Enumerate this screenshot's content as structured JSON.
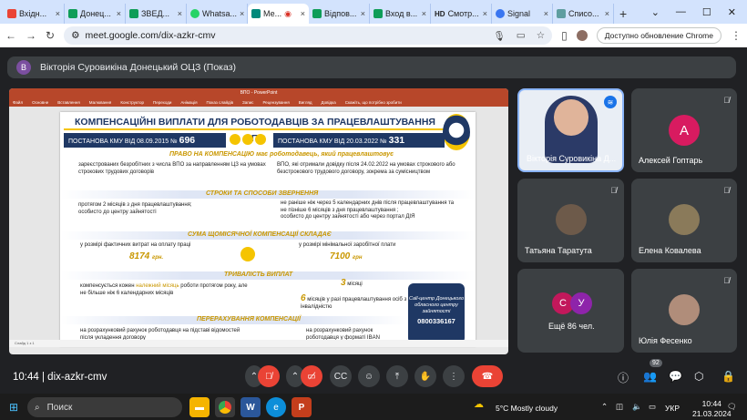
{
  "browser": {
    "tabs": [
      {
        "title": "Вхідн...",
        "color": "#ea4335"
      },
      {
        "title": "Донец...",
        "color": "#0f9d58"
      },
      {
        "title": "ЗВЕД...",
        "color": "#0f9d58"
      },
      {
        "title": "Whatsa...",
        "color": "#25d366"
      },
      {
        "title": "Ме...",
        "color": "#00897b"
      },
      {
        "title": "Відпов...",
        "color": "#0f9d58"
      },
      {
        "title": "Вход в...",
        "color": "#0f9d58"
      },
      {
        "title": "Смотр...",
        "color": "#202124"
      },
      {
        "title": "Signal",
        "color": "#3a76f0"
      },
      {
        "title": "Списо...",
        "color": "#5f9ea0"
      }
    ],
    "hd_label": "HD",
    "new_tab": "+",
    "url": "meet.google.com/dix-azkr-cmv",
    "update_button": "Доступно обновление Chrome"
  },
  "meet": {
    "presenter_initial": "В",
    "presenter_title": "Вікторія Суровикіна Донецький ОЦЗ (Показ)",
    "meeting_time": "10:44",
    "meeting_code": "dix-azkr-cmv",
    "participant_count": "92"
  },
  "ppt": {
    "window_title": "ВПО - PowerPoint",
    "menu": [
      "Файл",
      "Основне",
      "Вставлення",
      "Малювання",
      "Конструктор",
      "Переходи",
      "Анімація",
      "Показ слайдів",
      "Запис",
      "Рецензування",
      "Вигляд",
      "Довідка",
      "Скажіть, що потрібно зробити"
    ],
    "status": "Слайд 1 з 1"
  },
  "slide": {
    "title": "КОМПЕНСАЦІЙНІ ВИПЛАТИ ДЛЯ РОБОТОДАВЦІВ ЗА ПРАЦЕВЛАШТУВАННЯ ВПО",
    "left_header": "ПОСТАНОВА КМУ  ВІД 08.09.2015 №",
    "left_number": "696",
    "right_header": "ПОСТАНОВА КМУ  ВІД 20.03.2022 №",
    "right_number": "331",
    "right_banner": "ПРАВО НА КОМПЕНСАЦІЮ має роботодавець, який працевлаштовує",
    "left_who": "зареєстрованих безробітних з числа ВПО за направленням ЦЗ на умовах строкових трудових договорів",
    "right_who": "ВПО, які отримали довідку після 24.02.2022 на умовах строкового або безстрокового трудового договору, зокрема за сумісництвом",
    "terms_title": "СТРОКИ ТА СПОСОБИ ЗВЕРНЕННЯ",
    "left_terms": [
      "протягом 2 місяців з дня працевлаштування;",
      "особисто до центру зайнятості"
    ],
    "right_terms": [
      "не раніше ніж через 5 календарних днів після працевлаштування та не пізніше 6 місяців з дня працевлаштування ;",
      "особисто до центру зайнятості або через портал ДІЯ"
    ],
    "sum_title": "СУМА ЩОМІСЯЧНОЇ КОМПЕНСАЦІЇ СКЛАДАЄ",
    "left_sum_text": "у розмірі фактичних витрат на оплату праці",
    "left_sum": "8174",
    "left_sum_unit": "грн.",
    "right_sum_text": "у розмірі мінімальної заробітної плати",
    "right_sum": "7100",
    "right_sum_unit": "грн",
    "duration_title": "ТРИВАЛІСТЬ ВИПЛАТ",
    "left_duration": "компенсується кожен",
    "left_duration_highlight": "належний місяць",
    "left_duration_rest": "роботи протягом року, але не більше ніж 6 календарних місяців",
    "right_months_1": "3",
    "right_months_1_text": "місяці",
    "right_months_2": "6",
    "right_months_2_text": "місяців у разі працевлаштування осіб з інвалідністю",
    "transfer_title": "ПЕРЕРАХУВАННЯ КОМПЕНСАЦІЇ",
    "left_transfer": "на розрахунковий рахунок роботодавця на підставі відомостей після укладення договору",
    "right_transfer": "на розрахунковий рахунок роботодавця у форматі IBAN",
    "call_center": "Call-центр Донецького обласного центру зайнятості",
    "call_phone": "0800336167"
  },
  "participants": [
    {
      "name": "Вікторія Суровикіна Д...",
      "initial": ""
    },
    {
      "name": "Алексей Гоптарь",
      "initial": "А",
      "color": "#d81b60"
    },
    {
      "name": "Татьяна Таратута",
      "initial": ""
    },
    {
      "name": "Елена Ковалева",
      "initial": ""
    },
    {
      "name": "Ещё 86 чел.",
      "initials": [
        "С",
        "У"
      ]
    },
    {
      "name": "Юлія Фесенко",
      "initial": ""
    }
  ],
  "taskbar": {
    "search_placeholder": "Поиск",
    "weather": "5°C  Mostly cloudy",
    "lang": "УКР",
    "time": "10:44",
    "date": "21.03.2024"
  },
  "colors": {
    "accent": "#ea4335",
    "meet_bg": "#202124",
    "tile_bg": "#3c4043",
    "slide_navy": "#1f3864",
    "slide_gold": "#f5c400"
  }
}
